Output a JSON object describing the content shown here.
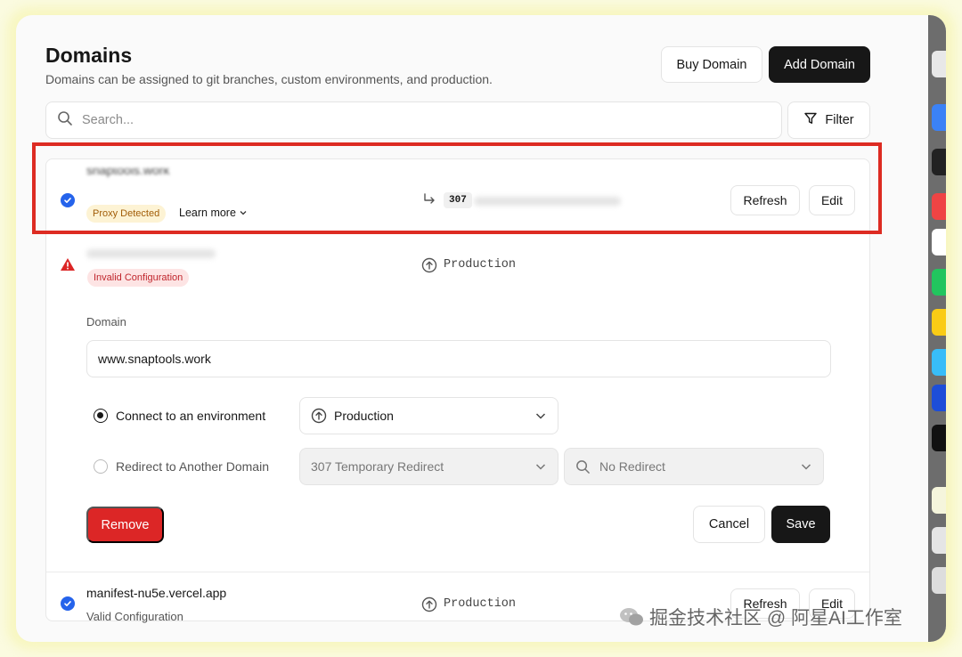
{
  "header": {
    "title": "Domains",
    "subtitle": "Domains can be assigned to git branches, custom environments, and production.",
    "buy_domain_label": "Buy Domain",
    "add_domain_label": "Add Domain"
  },
  "search": {
    "placeholder": "Search...",
    "filter_label": "Filter"
  },
  "domains": [
    {
      "name": "snaptools.work",
      "badge": "Proxy Detected",
      "learn_more": "Learn more",
      "redirect_code": "307",
      "refresh_label": "Refresh",
      "edit_label": "Edit"
    },
    {
      "badge": "Invalid Configuration",
      "environment": "Production",
      "edit_form": {
        "domain_label": "Domain",
        "domain_value": "www.snaptools.work",
        "connect_label": "Connect to an environment",
        "connect_value": "Production",
        "redirect_label": "Redirect to Another Domain",
        "redirect_type": "307 Temporary Redirect",
        "redirect_target": "No Redirect",
        "remove_label": "Remove",
        "cancel_label": "Cancel",
        "save_label": "Save"
      }
    },
    {
      "name": "manifest-nu5e.vercel.app",
      "status": "Valid Configuration",
      "environment": "Production",
      "refresh_label": "Refresh",
      "edit_label": "Edit"
    }
  ],
  "watermark": {
    "text": "掘金技术社区 @ 阿星AI工作室"
  },
  "colors": {
    "accent_blue": "#2563eb",
    "danger_red": "#dc2626",
    "highlight_red": "#dd2b22",
    "dark_button": "#171717"
  }
}
